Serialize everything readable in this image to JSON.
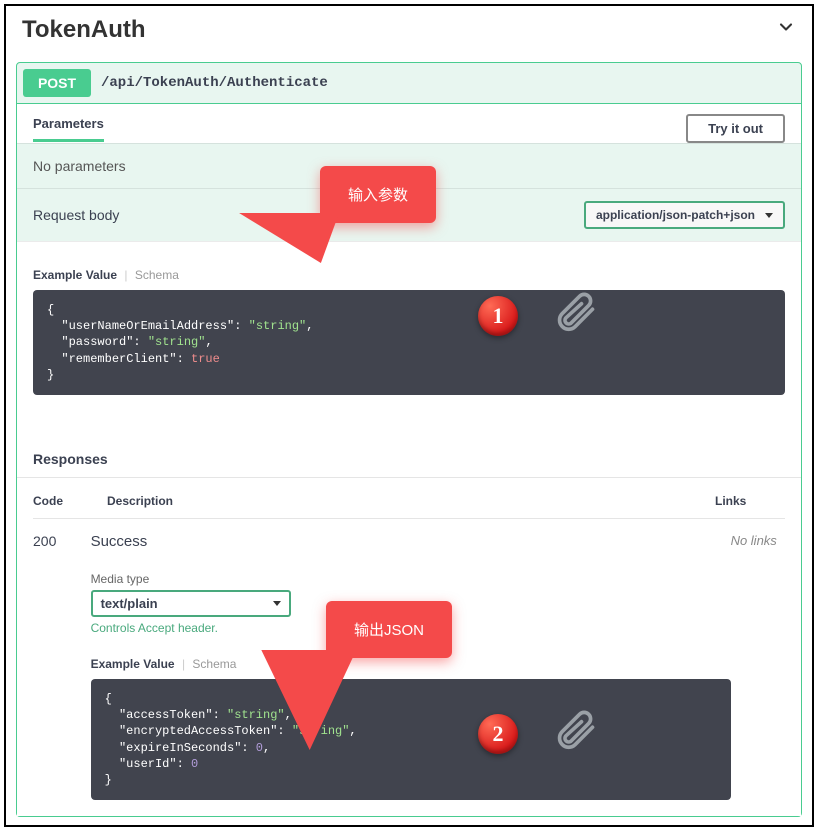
{
  "title": "TokenAuth",
  "endpoint": {
    "method": "POST",
    "path": "/api/TokenAuth/Authenticate"
  },
  "parameters": {
    "header": "Parameters",
    "tryout": "Try it out",
    "none": "No parameters"
  },
  "request_body": {
    "label": "Request body",
    "content_type": "application/json-patch+json",
    "tabs": {
      "example": "Example Value",
      "schema": "Schema"
    },
    "example": "{\n  \"userNameOrEmailAddress\": \"string\",\n  \"password\": \"string\",\n  \"rememberClient\": true\n}"
  },
  "responses": {
    "header": "Responses",
    "columns": {
      "code": "Code",
      "description": "Description",
      "links": "Links"
    },
    "row": {
      "code": "200",
      "description": "Success",
      "links": "No links",
      "media_type_label": "Media type",
      "media_type": "text/plain",
      "hint": "Controls Accept header.",
      "tabs": {
        "example": "Example Value",
        "schema": "Schema"
      },
      "example": "{\n  \"accessToken\": \"string\",\n  \"encryptedAccessToken\": \"string\",\n  \"expireInSeconds\": 0,\n  \"userId\": 0\n}"
    }
  },
  "annotations": {
    "callout1": "输入参数",
    "callout2": "输出JSON",
    "badge1": "1",
    "badge2": "2"
  }
}
